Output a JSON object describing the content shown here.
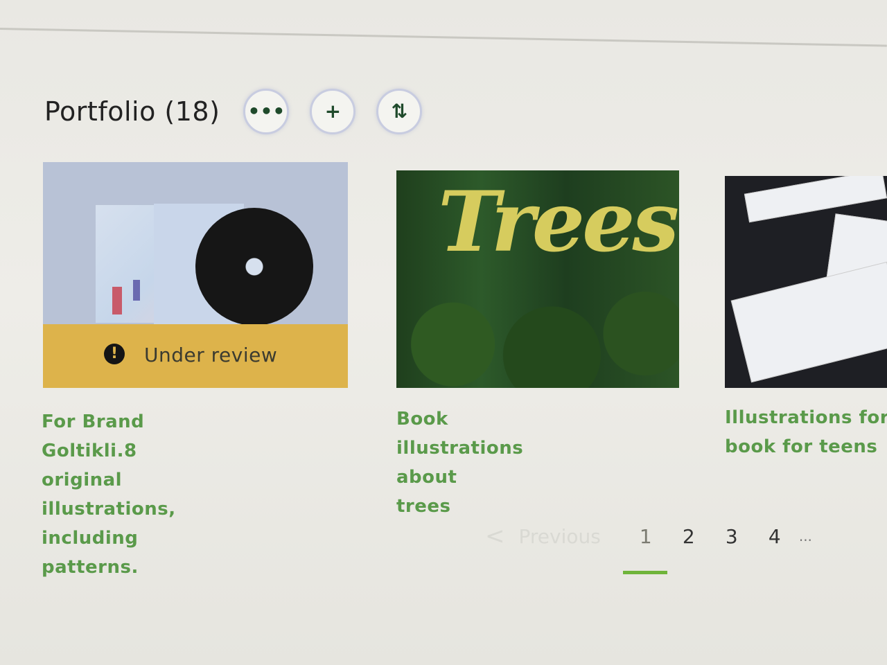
{
  "header": {
    "title": "Portfolio (18)"
  },
  "actions": {
    "more_label": "•••",
    "add_label": "+",
    "sort_label": "⇅"
  },
  "cards": [
    {
      "title_lines": [
        "For Brand Goltikli.8",
        "original illustrations,",
        "including patterns."
      ],
      "status": "Under review",
      "status_icon": "!"
    },
    {
      "title_lines": [
        "Book illustrations about",
        "trees"
      ],
      "image_text": "Trees"
    },
    {
      "title_lines": [
        "Illustrations for a",
        "book for teens"
      ]
    }
  ],
  "pagination": {
    "previous_label": "Previous",
    "chevron": "<",
    "pages": [
      "1",
      "2",
      "3",
      "4"
    ],
    "ellipsis": "...",
    "current": "1"
  },
  "colors": {
    "accent_green": "#6fb43a",
    "title_green": "#5a9a4a",
    "review_yellow": "#ddb34b"
  }
}
